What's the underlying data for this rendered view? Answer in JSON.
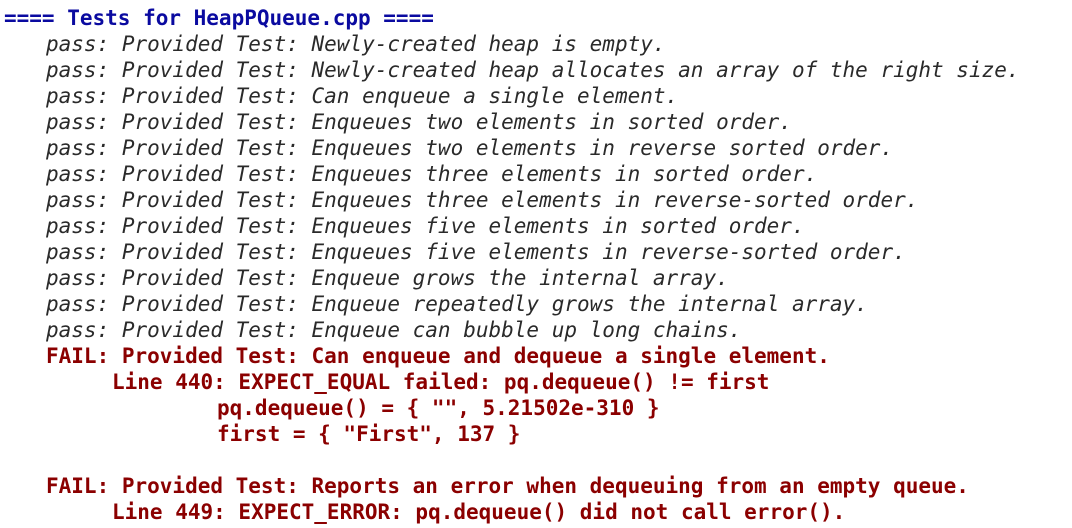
{
  "header": "==== Tests for HeapPQueue.cpp ====",
  "passes": [
    "pass: Provided Test: Newly-created heap is empty.",
    "pass: Provided Test: Newly-created heap allocates an array of the right size.",
    "pass: Provided Test: Can enqueue a single element.",
    "pass: Provided Test: Enqueues two elements in sorted order.",
    "pass: Provided Test: Enqueues two elements in reverse sorted order.",
    "pass: Provided Test: Enqueues three elements in sorted order.",
    "pass: Provided Test: Enqueues three elements in reverse-sorted order.",
    "pass: Provided Test: Enqueues five elements in sorted order.",
    "pass: Provided Test: Enqueues five elements in reverse-sorted order.",
    "pass: Provided Test: Enqueue grows the internal array.",
    "pass: Provided Test: Enqueue repeatedly grows the internal array.",
    "pass: Provided Test: Enqueue can bubble up long chains."
  ],
  "failures": [
    {
      "title": "FAIL: Provided Test: Can enqueue and dequeue a single element.",
      "line": "Line 440: EXPECT_EQUAL failed: pq.dequeue() != first",
      "details": [
        "pq.dequeue() = { \"\", 5.21502e-310 }",
        "first = { \"First\", 137 }"
      ]
    },
    {
      "title": "FAIL: Provided Test: Reports an error when dequeuing from an empty queue.",
      "line": "Line 449: EXPECT_ERROR: pq.dequeue() did not call error()."
    }
  ]
}
